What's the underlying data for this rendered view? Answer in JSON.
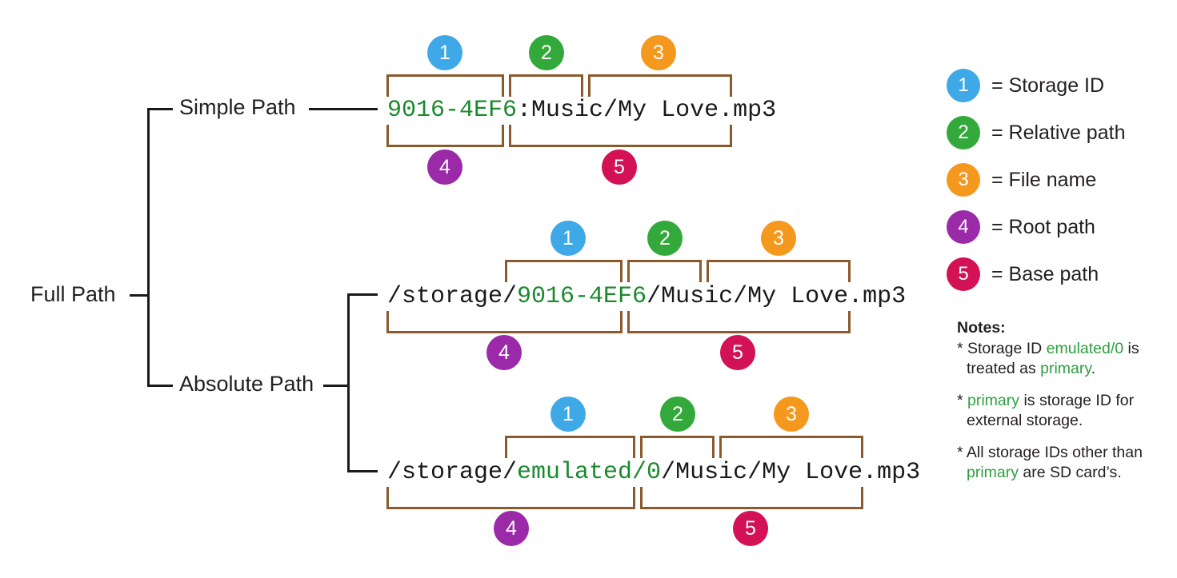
{
  "diagram": {
    "title_nodes": {
      "root": "Full Path",
      "child_simple": "Simple Path",
      "child_absolute": "Absolute Path"
    }
  },
  "rows": [
    {
      "id": "simple-path",
      "kind": "Simple Path",
      "storage_id": "9016-4EF6",
      "separator": ":",
      "relative_path": "Music/",
      "file_name": "My Love.mp3",
      "full_text": "9016-4EF6:Music/My Love.mp3",
      "root_path": "9016-4EF6:",
      "base_path": "Music/My Love.mp3"
    },
    {
      "id": "absolute-path-sdcard",
      "kind": "Absolute Path",
      "prefix": "/storage/",
      "storage_id": "9016-4EF6",
      "separator": "/",
      "relative_path": "Music/",
      "file_name": "My Love.mp3",
      "full_text": "/storage/9016-4EF6/Music/My Love.mp3",
      "root_path": "/storage/9016-4EF6/",
      "base_path": "Music/My Love.mp3"
    },
    {
      "id": "absolute-path-emulated",
      "kind": "Absolute Path",
      "prefix": "/storage/",
      "storage_id": "emulated/0",
      "separator": "/",
      "relative_path": "Music/",
      "file_name": "My Love.mp3",
      "full_text": "/storage/emulated/0/Music/My Love.mp3",
      "root_path": "/storage/emulated/0/",
      "base_path": "Music/My Love.mp3"
    }
  ],
  "markers": {
    "one": "1",
    "two": "2",
    "three": "3",
    "four": "4",
    "five": "5"
  },
  "legend": {
    "items": [
      {
        "number": "1",
        "label": "= Storage ID",
        "color": "#3fa9e8"
      },
      {
        "number": "2",
        "label": "= Relative path",
        "color": "#34a93b"
      },
      {
        "number": "3",
        "label": "= File name",
        "color": "#f5981e"
      },
      {
        "number": "4",
        "label": "= Root path",
        "color": "#9b2aa8"
      },
      {
        "number": "5",
        "label": "= Base path",
        "color": "#d31155"
      }
    ]
  },
  "notes": {
    "title": "Notes:",
    "items": [
      {
        "parts": [
          {
            "text": "* Storage ID ",
            "green": false
          },
          {
            "text": "emulated/0",
            "green": true
          },
          {
            "text": " is treated as ",
            "green": false
          },
          {
            "text": "primary",
            "green": true
          },
          {
            "text": ".",
            "green": false
          }
        ]
      },
      {
        "parts": [
          {
            "text": "* ",
            "green": false
          },
          {
            "text": "primary",
            "green": true
          },
          {
            "text": " is storage ID for external storage.",
            "green": false
          }
        ]
      },
      {
        "parts": [
          {
            "text": "* All storage IDs other than ",
            "green": false
          },
          {
            "text": "primary",
            "green": true
          },
          {
            "text": " are SD card’s.",
            "green": false
          }
        ]
      }
    ]
  },
  "colors": {
    "bracket": "#8b5a2b",
    "tree_line": "#1a1a1a",
    "storage_id_green": "#1b8a2e",
    "text": "#231f20"
  }
}
